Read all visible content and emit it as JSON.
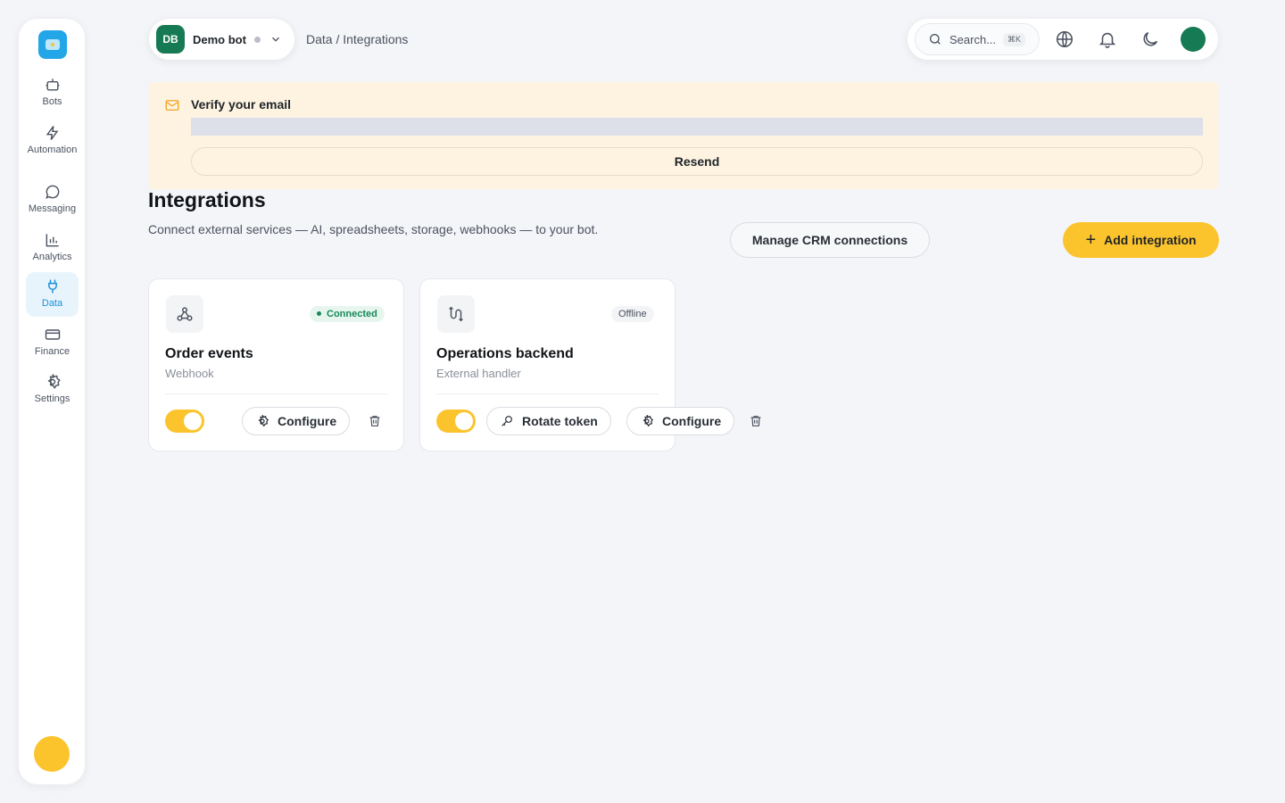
{
  "sidebar": {
    "items": [
      {
        "label": "Bots",
        "icon": "bot-icon"
      },
      {
        "label": "Automation",
        "icon": "lightning-icon"
      },
      {
        "label": "Messaging",
        "icon": "chat-bubble-icon"
      },
      {
        "label": "Analytics",
        "icon": "bar-chart-icon"
      },
      {
        "label": "Data",
        "icon": "plug-icon",
        "active": true
      },
      {
        "label": "Finance",
        "icon": "credit-card-icon"
      },
      {
        "label": "Settings",
        "icon": "gear-icon"
      }
    ]
  },
  "header": {
    "bot_initials": "DB",
    "bot_name": "Demo bot",
    "breadcrumb": "Data / Integrations",
    "search_placeholder": "Search...",
    "search_shortcut": "⌘K"
  },
  "banner": {
    "title": "Verify your email",
    "resend_label": "Resend"
  },
  "page": {
    "title": "Integrations",
    "description": "Connect external services — AI, spreadsheets, storage, webhooks — to your bot.",
    "manage_crm_label": "Manage CRM connections",
    "add_label": "Add integration"
  },
  "integrations": [
    {
      "name": "Order events",
      "type": "Webhook",
      "status": "Connected",
      "enabled": true,
      "icon": "webhook-icon",
      "configure_label": "Configure"
    },
    {
      "name": "Operations backend",
      "type": "External handler",
      "status": "Offline",
      "enabled": true,
      "icon": "routing-icon",
      "rotate_label": "Rotate token",
      "configure_label": "Configure"
    }
  ],
  "colors": {
    "accent": "#fbc42d",
    "active_nav": "#1d8fd6",
    "bot_avatar": "#167a54",
    "connected": "#19875a",
    "banner_bg": "#fdf3e0"
  }
}
